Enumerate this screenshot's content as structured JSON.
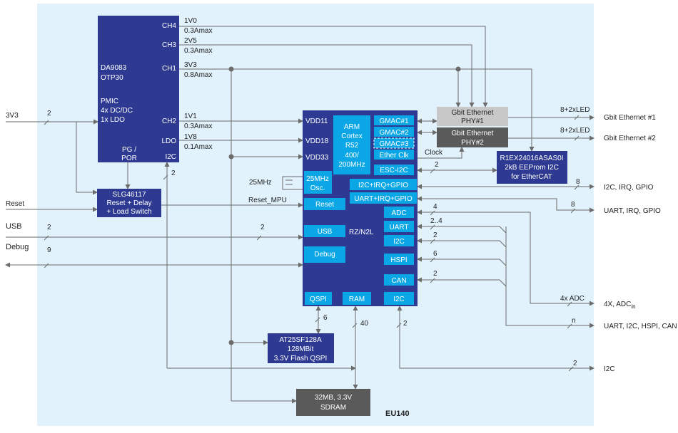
{
  "board": "EU140",
  "pmic": {
    "name": "DA9083",
    "variant": "OTP30",
    "type": "PMIC",
    "dcdc": "4x DC/DC",
    "ldo": "1x LDO",
    "ch4": "CH4",
    "ch3": "CH3",
    "ch1": "CH1",
    "ch2": "CH2",
    "ldo_pin": "LDO",
    "pg_por": "PG /",
    "por": "POR",
    "i2c": "I2C"
  },
  "rails": {
    "ch4_v": "1V0",
    "ch4_a": "0.3Amax",
    "ch3_v": "2V5",
    "ch3_a": "0.3Amax",
    "ch1_v": "3V3",
    "ch1_a": "0.8Amax",
    "ch2_v": "1V1",
    "ch2_a": "0.3Amax",
    "ldo_v": "1V8",
    "ldo_a": "0.1Amax"
  },
  "slg": {
    "name": "SLG46117",
    "line2": "Reset + Delay",
    "line3": "+ Load Switch"
  },
  "mpu": {
    "name": "RZ/N2L",
    "vdd11": "VDD11",
    "vdd18": "VDD18",
    "vdd33": "VDD33",
    "arm": [
      "ARM",
      "Cortex",
      "R52",
      "400/",
      "200MHz"
    ],
    "gmac1": "GMAC#1",
    "gmac2": "GMAC#2",
    "gmac3": "GMAC#3",
    "etherclk": "Ether Clk",
    "esci2c": "ESC-I2C",
    "osc": [
      "25MHz",
      "Osc."
    ],
    "i2cirq": "I2C+IRQ+GPIO",
    "uartirq": "UART+IRQ+GPIO",
    "reset": "Reset",
    "adc": "ADC",
    "uart": "UART",
    "i2c": "I2C",
    "usb": "USB",
    "debug": "Debug",
    "hspi": "HSPI",
    "can": "CAN",
    "qspi": "QSPI",
    "ram": "RAM",
    "i2c2": "I2C"
  },
  "phy1": [
    "Gbit Ethernet",
    "PHY#1"
  ],
  "phy2": [
    "Gbit Ethernet",
    "PHY#2"
  ],
  "eeprom": [
    "R1EX24016ASAS0I",
    "2kB EEProm I2C",
    "for EtherCAT"
  ],
  "flash": [
    "AT25SF128A",
    "128MBit",
    "3.3V Flash QSPI"
  ],
  "sdram": [
    "32MB, 3.3V",
    "SDRAM"
  ],
  "labels": {
    "in3v3": "3V3",
    "reset": "Reset",
    "usb": "USB",
    "debug": "Debug",
    "reset_mpu": "Reset_MPU",
    "xtal": "25MHz",
    "clock": "Clock"
  },
  "bus": {
    "in3v3": "2",
    "usb1": "2",
    "usb2": "2",
    "debug": "9",
    "pmic_i2c": "2",
    "esc": "2",
    "led1": "8+2xLED",
    "led2": "8+2xLED",
    "i2cirq": "8",
    "uartirq": "8",
    "adc": "4",
    "uart": "2..4",
    "i2c": "2",
    "hspi": "6",
    "can": "2",
    "adc_out": "4x ADC",
    "n": "n",
    "qspi": "6",
    "ram": "40",
    "i2c_b": "2",
    "i2c_out": "2"
  },
  "outputs": {
    "eth1": "Gbit Ethernet #1",
    "eth2": "Gbit Ethernet #2",
    "i2cirq": "I2C, IRQ, GPIO",
    "uartirq": "UART, IRQ, GPIO",
    "adc": "4X, ADC",
    "adc_sub": "in",
    "multi": "UART, I2C, HSPI, CAN",
    "i2c": "I2C"
  },
  "colors": {
    "block": "#2e3a92",
    "sub": "#0aa6e6",
    "phy1": "#c8c8c8",
    "phy2": "#5a5a5a",
    "bg": "#e1f2fc"
  }
}
